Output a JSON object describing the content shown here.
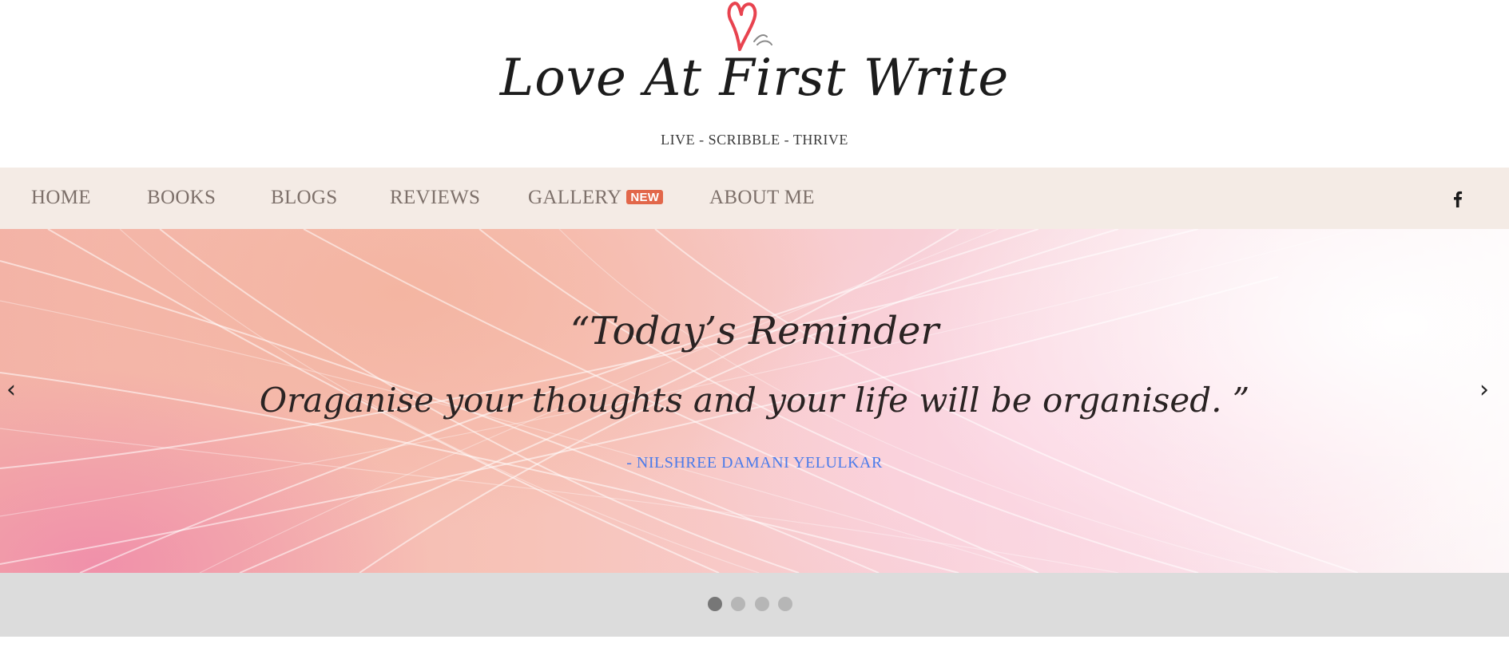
{
  "header": {
    "title": "Love At First Write",
    "tagline": "LIVE - SCRIBBLE - THRIVE"
  },
  "nav": {
    "items": [
      {
        "label": "HOME"
      },
      {
        "label": "BOOKS"
      },
      {
        "label": "BLOGS"
      },
      {
        "label": "REVIEWS"
      },
      {
        "label": "GALLERY",
        "badge": "NEW"
      },
      {
        "label": "ABOUT ME"
      }
    ],
    "social_icon": "facebook-icon"
  },
  "carousel": {
    "quote_line1": "“Today’s Reminder",
    "quote_line2": "Oraganise your thoughts and your life will be organised. ”",
    "author": "- NILSHREE DAMANI YELULKAR",
    "prev_arrow": "‹",
    "next_arrow": "›",
    "slide_count": 4,
    "active_slide": 1
  },
  "colors": {
    "nav_background": "#f4ebe5",
    "nav_text": "#7d706a",
    "badge": "#e2674a",
    "author_link": "#4b7bea",
    "heart": "#e8434f",
    "dots_bar": "#dcdcdc"
  }
}
